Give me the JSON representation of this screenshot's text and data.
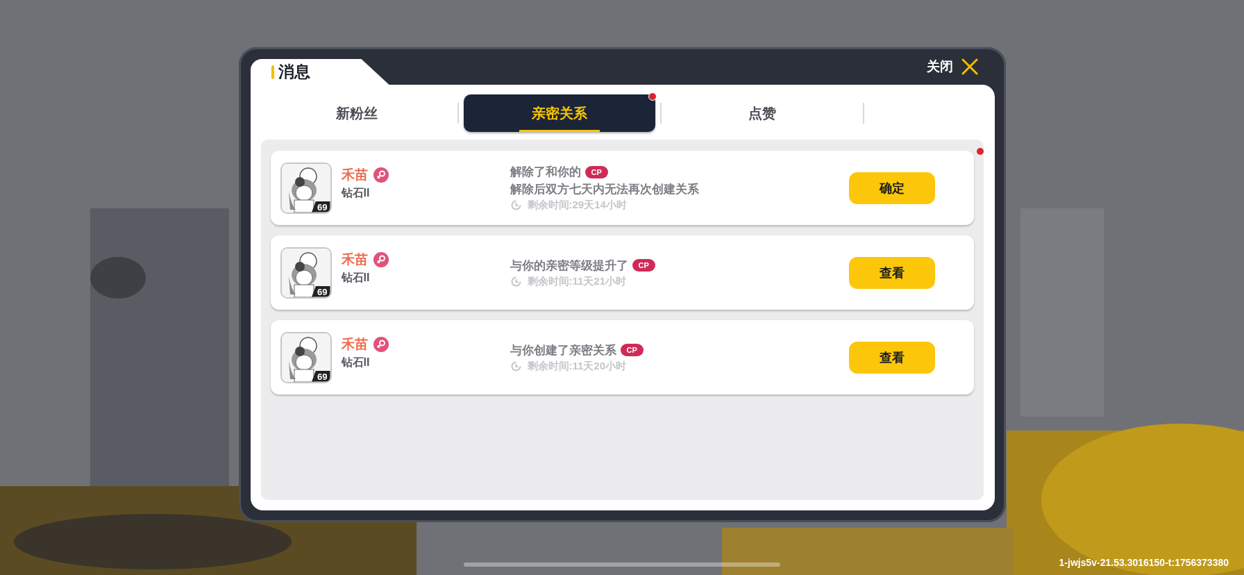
{
  "title": "消息",
  "close_label": "关闭",
  "tabs": [
    {
      "label": "新粉丝",
      "selected": false,
      "unread": false
    },
    {
      "label": "亲密关系",
      "selected": true,
      "unread": true
    },
    {
      "label": "点赞",
      "selected": false,
      "unread": false
    }
  ],
  "messages": [
    {
      "name": "禾苗",
      "rank": "钻石II",
      "level": "69",
      "text": "解除了和你的",
      "badge": "CP",
      "note": "解除后双方七天内无法再次创建关系",
      "remaining": "剩余时间:29天14小时",
      "action": "确定",
      "unread": true
    },
    {
      "name": "禾苗",
      "rank": "钻石II",
      "level": "69",
      "text": "与你的亲密等级提升了",
      "badge": "CP",
      "remaining": "剩余时间:11天21小时",
      "action": "查看",
      "unread": false
    },
    {
      "name": "禾苗",
      "rank": "钻石II",
      "level": "69",
      "text": "与你创建了亲密关系",
      "badge": "CP",
      "remaining": "剩余时间:11天20小时",
      "action": "查看",
      "unread": false
    }
  ],
  "build_id": "1-jwjs5v-21.53.3016150-t:1756373380"
}
